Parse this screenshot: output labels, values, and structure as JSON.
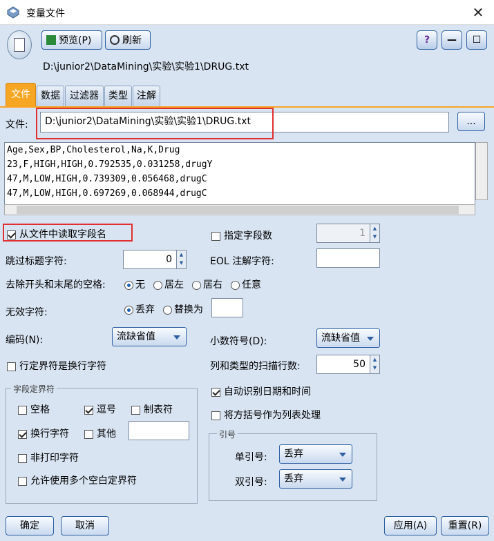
{
  "window": {
    "title": "变量文件",
    "close_label": "✕"
  },
  "toolbar": {
    "preview_label": "预览(P)",
    "refresh_label": "刷新",
    "path": "D:\\junior2\\DataMining\\实验\\实验1\\DRUG.txt",
    "help_label": "?",
    "min_label": "—",
    "max_label": "☐"
  },
  "tabs": [
    "文件",
    "数据",
    "过滤器",
    "类型",
    "注解"
  ],
  "file": {
    "label": "文件:",
    "path": "D:\\junior2\\DataMining\\实验\\实验1\\DRUG.txt",
    "browse_label": "..."
  },
  "preview_lines": [
    "Age,Sex,BP,Cholesterol,Na,K,Drug",
    "23,F,HIGH,HIGH,0.792535,0.031258,drugY",
    "47,M,LOW,HIGH,0.739309,0.056468,drugC",
    "47,M,LOW,HIGH,0.697269,0.068944,drugC"
  ],
  "options": {
    "read_field_names": "从文件中读取字段名",
    "specify_fields": "指定字段数",
    "field_count": "1",
    "skip_header": "跳过标题字符:",
    "skip_value": "0",
    "eol_comment": "EOL 注解字符:",
    "strip_spaces": "去除开头和末尾的空格:",
    "strip_none": "无",
    "strip_left": "居左",
    "strip_right": "居右",
    "strip_any": "任意",
    "invalid_chars": "无效字符:",
    "discard": "丢弃",
    "replace_with": "替换为",
    "encoding": "编码(N):",
    "encoding_value": "流缺省值",
    "decimal": "小数符号(D):",
    "decimal_value": "流缺省值",
    "newline_record": "行定界符是换行字符",
    "scan_rows": "列和类型的扫描行数:",
    "scan_value": "50",
    "auto_date": "自动识别日期和时间",
    "bracket_list": "将方括号作为列表处理"
  },
  "delimiters": {
    "group_label": "字段定界符",
    "space": "空格",
    "comma": "逗号",
    "tab": "制表符",
    "newline": "换行字符",
    "other": "其他",
    "nonprint": "非打印字符",
    "multi_space": "允许使用多个空白定界符"
  },
  "quotes": {
    "group_label": "引号",
    "single": "单引号:",
    "single_value": "丢弃",
    "double": "双引号:",
    "double_value": "丢弃"
  },
  "buttons": {
    "ok": "确定",
    "cancel": "取消",
    "apply": "应用(A)",
    "reset": "重置(R)"
  }
}
